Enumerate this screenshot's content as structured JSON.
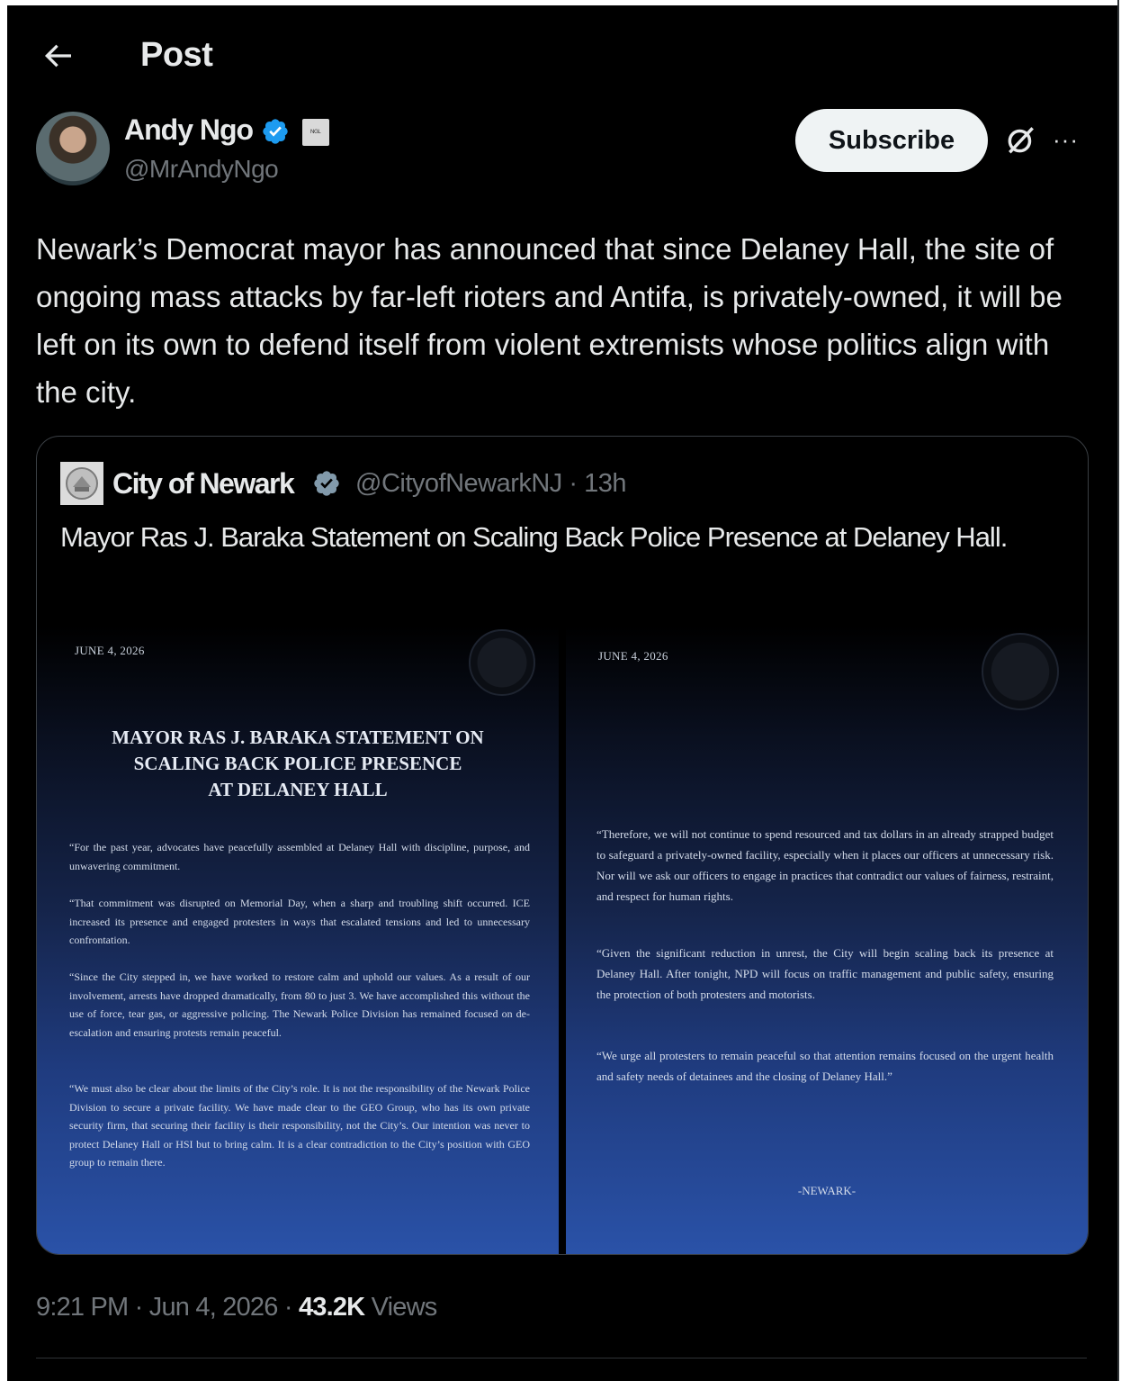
{
  "header": {
    "title": "Post"
  },
  "author": {
    "name": "Andy Ngo",
    "handle": "@MrAndyNgo",
    "affiliate_badge": "ᴺᴳᴸ"
  },
  "actions": {
    "subscribe_label": "Subscribe",
    "more_label": "···"
  },
  "post": {
    "text": "Newark’s Democrat mayor has announced that since Delaney Hall, the site of ongoing mass attacks by far-left rioters and Antifa, is privately-owned, it will be left on its own to defend itself from violent extremists whose politics align with the city.",
    "time": "9:21 PM",
    "sep1": " · ",
    "date": "Jun 4, 2026",
    "sep2": " · ",
    "views_count": "43.2K",
    "views_label": " Views"
  },
  "quote": {
    "name": "City of Newark",
    "handle": "@CityofNewarkNJ · 13h",
    "text": "Mayor Ras J. Baraka Statement on Scaling Back Police Presence at Delaney Hall.",
    "image_left": {
      "date": "JUNE 4, 2026",
      "title_line1": "MAYOR RAS J. BARAKA STATEMENT ON",
      "title_line2": "SCALING BACK POLICE PRESENCE",
      "title_line3": "AT DELANEY HALL",
      "p1": "“For the past year, advocates have peacefully assembled at Delaney Hall with discipline, purpose, and unwavering commitment.",
      "p2": "“That commitment was disrupted on Memorial Day, when a sharp and troubling shift occurred. ICE increased its presence and engaged protesters in ways that escalated tensions and led to unnecessary confrontation.",
      "p3": "“Since the City stepped in, we have worked to restore calm and uphold our values. As a result of our involvement, arrests have dropped dramatically, from 80 to just 3. We have accomplished this without the use of force, tear gas, or aggressive policing. The Newark Police Division has remained focused on de-escalation and ensuring protests remain peaceful.",
      "p4": "“We must also be clear about the limits of the City’s role. It is not the responsibility of the Newark Police Division to secure a private facility. We have made clear to the GEO Group, who has its own private security firm, that securing their facility is their responsibility, not the City’s. Our intention was never to protect Delaney Hall or HSI but to bring calm. It is a clear contradiction to the City’s position with GEO group to remain there."
    },
    "image_right": {
      "date": "JUNE 4, 2026",
      "p1": "“Therefore, we will not continue to spend resourced and tax dollars in an already strapped budget to safeguard a privately-owned facility, especially when it places our officers at unnecessary risk. Nor will we ask our officers to engage in practices that contradict our values of fairness, restraint, and respect for human rights.",
      "p2": "“Given the significant reduction in unrest, the City will begin scaling back its presence at Delaney Hall. After tonight, NPD will focus on traffic management and public safety, ensuring the protection of both protesters and motorists.",
      "p3": "“We urge all protesters to remain peaceful so that attention remains focused on the urgent health and safety needs of detainees and the closing of Delaney Hall.”",
      "footer": "-NEWARK-"
    }
  },
  "colors": {
    "background": "#000000",
    "text": "#e7e9ea",
    "muted": "#71767b",
    "verified": "#1d9bf0",
    "gray_verified": "#829aab",
    "button_bg": "#eff3f4"
  },
  "icons": [
    "back-arrow-icon",
    "verified-badge-icon",
    "affiliate-badge-icon",
    "grok-icon",
    "more-icon",
    "gray-verified-badge-icon"
  ]
}
